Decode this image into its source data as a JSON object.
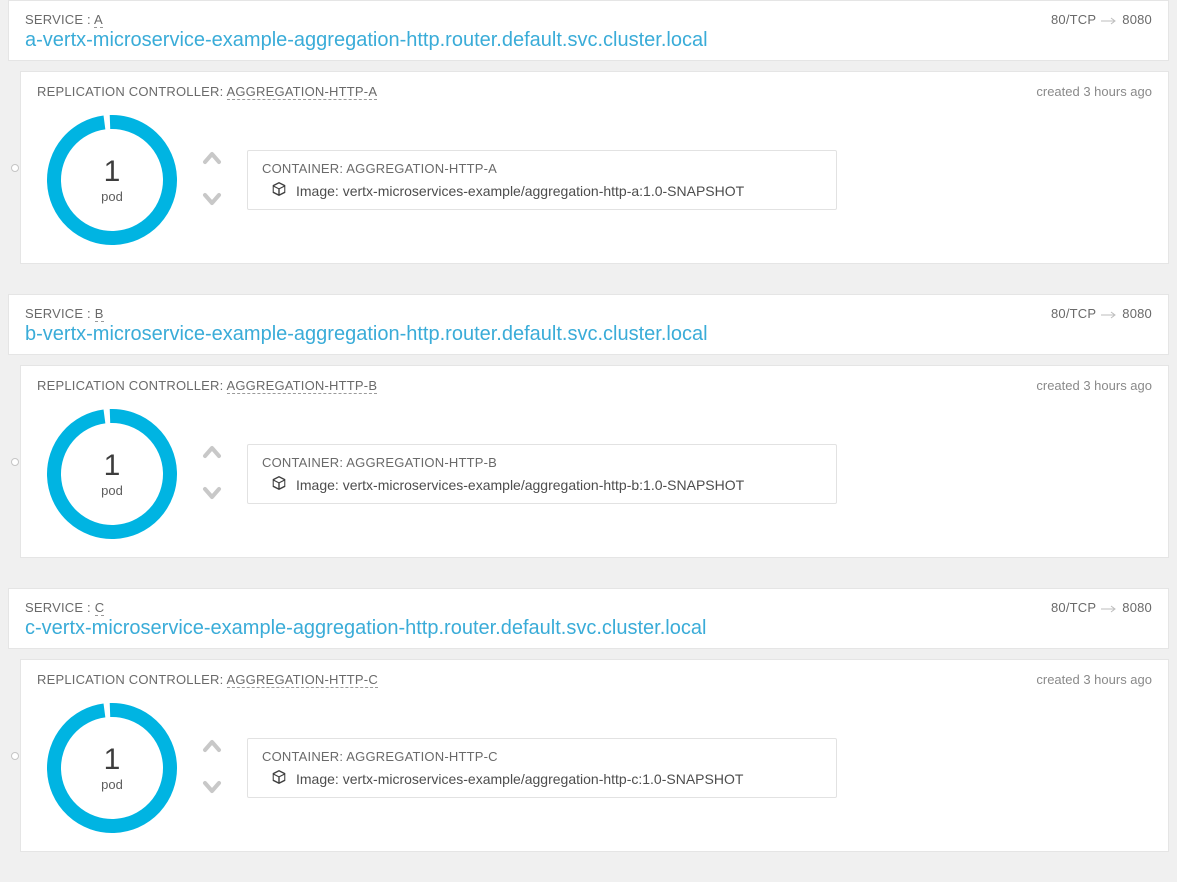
{
  "services": [
    {
      "label_prefix": "SERVICE : ",
      "label_link": "A",
      "port_from": "80/TCP",
      "port_to": "8080",
      "url": "a-vertx-microservice-example-aggregation-http.router.default.svc.cluster.local",
      "rc": {
        "title_prefix": "REPLICATION CONTROLLER: ",
        "title_link": "AGGREGATION-HTTP-A",
        "created": "created 3 hours ago",
        "pod_count": "1",
        "pod_label": "pod",
        "container_title": "CONTAINER: AGGREGATION-HTTP-A",
        "image_prefix": "Image: ",
        "image": "vertx-microservices-example/aggregation-http-a:1.0-SNAPSHOT"
      }
    },
    {
      "label_prefix": "SERVICE : ",
      "label_link": "B",
      "port_from": "80/TCP",
      "port_to": "8080",
      "url": "b-vertx-microservice-example-aggregation-http.router.default.svc.cluster.local",
      "rc": {
        "title_prefix": "REPLICATION CONTROLLER: ",
        "title_link": "AGGREGATION-HTTP-B",
        "created": "created 3 hours ago",
        "pod_count": "1",
        "pod_label": "pod",
        "container_title": "CONTAINER: AGGREGATION-HTTP-B",
        "image_prefix": "Image: ",
        "image": "vertx-microservices-example/aggregation-http-b:1.0-SNAPSHOT"
      }
    },
    {
      "label_prefix": "SERVICE : ",
      "label_link": "C",
      "port_from": "80/TCP",
      "port_to": "8080",
      "url": "c-vertx-microservice-example-aggregation-http.router.default.svc.cluster.local",
      "rc": {
        "title_prefix": "REPLICATION CONTROLLER: ",
        "title_link": "AGGREGATION-HTTP-C",
        "created": "created 3 hours ago",
        "pod_count": "1",
        "pod_label": "pod",
        "container_title": "CONTAINER: AGGREGATION-HTTP-C",
        "image_prefix": "Image: ",
        "image": "vertx-microservices-example/aggregation-http-c:1.0-SNAPSHOT"
      }
    }
  ],
  "colors": {
    "accent": "#00b4e2",
    "link": "#3aacd8"
  }
}
